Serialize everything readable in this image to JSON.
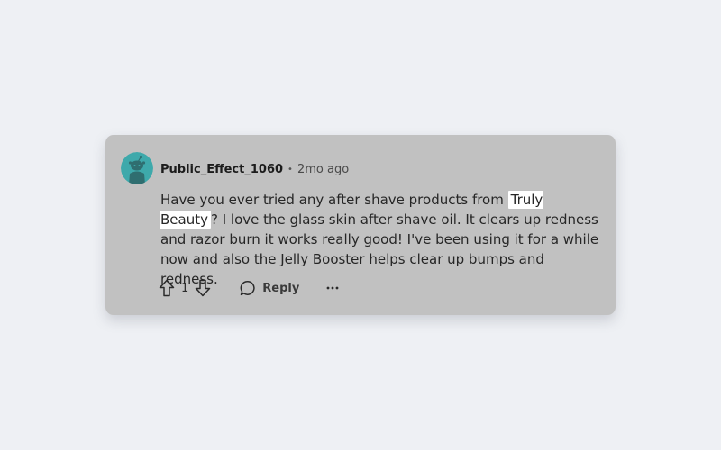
{
  "comment": {
    "username": "Public_Effect_1060",
    "separator": "•",
    "timestamp": "2mo ago",
    "text_before": "Have you ever tried any after shave products from ",
    "highlight": "Truly Beauty",
    "text_after": "? I love the glass skin after shave oil. It clears up redness and razor burn it works really good! I've been using it for a while now and also the Jelly Booster helps clear up bumps and redness.",
    "vote_count": "1",
    "reply_label": "Reply",
    "more_label": "•••"
  },
  "colors": {
    "page_background": "#eef0f4",
    "card_background": "#c1c1c1",
    "avatar_teal": "#3ea9ab",
    "highlight_background": "#ffffff"
  },
  "icons": {
    "avatar": "snoo-avatar-icon",
    "upvote": "upvote-arrow-icon",
    "downvote": "downvote-arrow-icon",
    "reply": "comment-bubble-icon",
    "more": "more-options-icon"
  }
}
